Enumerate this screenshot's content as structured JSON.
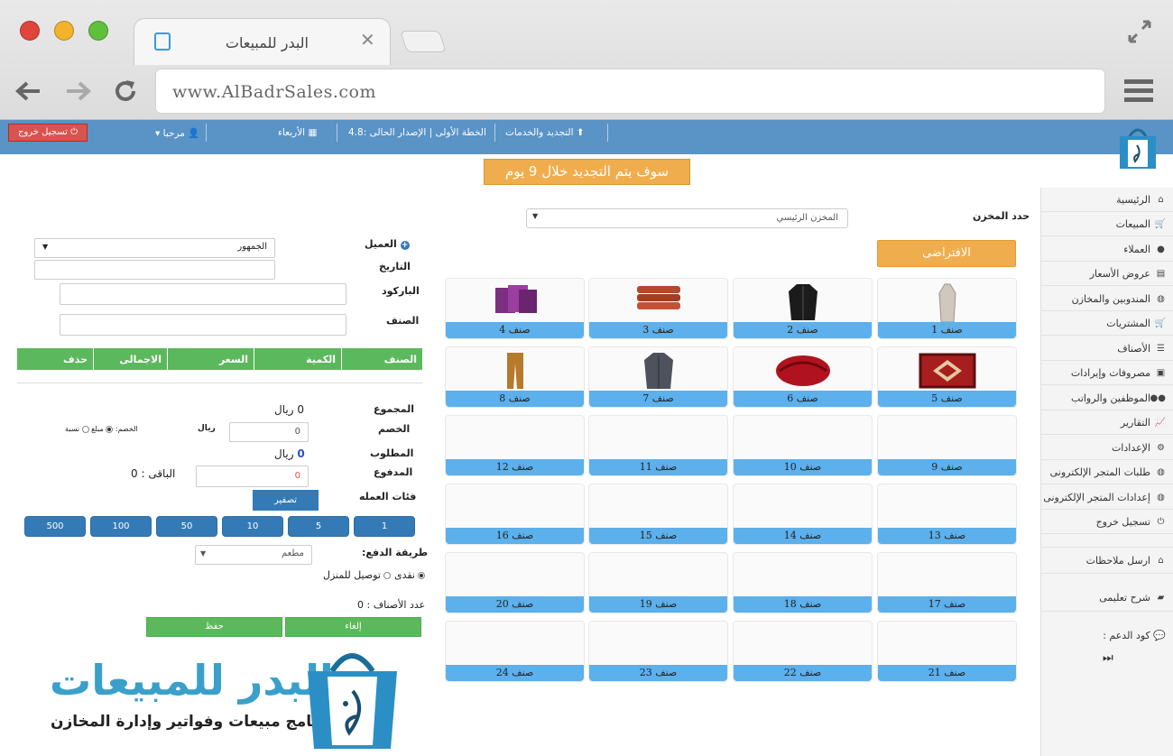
{
  "browser": {
    "tab_title": "البدر للمبيعات",
    "tab_close": "✕",
    "url": "www.AlBadrSales.com"
  },
  "topbar": {
    "logout": "تسجيل خروج",
    "welcome": "مرحبا",
    "day": "الأربعاء",
    "plan": "الخطة الأولى | الإصدار الحالى :4.8",
    "renewal": "التجديد والخدمات"
  },
  "notice": "سوف يتم التجديد خلال 9 يوم",
  "sidebar": {
    "items": [
      {
        "label": "الرئيسية",
        "icon": "home-icon"
      },
      {
        "label": "المبيعات",
        "icon": "cart-icon"
      },
      {
        "label": "العملاء",
        "icon": "user-icon"
      },
      {
        "label": "عروض الأسعار",
        "icon": "list-icon"
      },
      {
        "label": "المندوبين والمخازن",
        "icon": "globe-icon"
      },
      {
        "label": "المشتريات",
        "icon": "cart-plus-icon"
      },
      {
        "label": "الأصناف",
        "icon": "list-icon"
      },
      {
        "label": "مصروفات وإيرادات",
        "icon": "money-icon"
      },
      {
        "label": "الموظفين والرواتب",
        "icon": "users-icon"
      },
      {
        "label": "التقارير",
        "icon": "chart-icon"
      },
      {
        "label": "الإعدادات",
        "icon": "gears-icon"
      },
      {
        "label": "طلبات المتجر الإلكترونى",
        "icon": "globe-icon"
      },
      {
        "label": "إعدادات المتجر الإلكترونى",
        "icon": "globe-icon"
      },
      {
        "label": "تسجيل خروج",
        "icon": "power-icon"
      }
    ],
    "feedback": "ارسل ملاحظات",
    "tutorial": "شرح تعليمى",
    "support_code": "كود الدعم :",
    "media": "⏭"
  },
  "warehouse": {
    "label": "حدد المخزن",
    "selected": "المخزن الرئيسي",
    "default_button": "الافتراضى"
  },
  "products": [
    "صنف 1",
    "صنف 2",
    "صنف 3",
    "صنف 4",
    "صنف 5",
    "صنف 6",
    "صنف 7",
    "صنف 8",
    "صنف 9",
    "صنف 10",
    "صنف 11",
    "صنف 12",
    "صنف 13",
    "صنف 14",
    "صنف 15",
    "صنف 16",
    "صنف 17",
    "صنف 18",
    "صنف 19",
    "صنف 20",
    "صنف 21",
    "صنف 22",
    "صنف 23",
    "صنف 24"
  ],
  "pos": {
    "customer_label": "العميل",
    "customer_value": "الجمهور",
    "date_label": "التاريخ",
    "barcode_label": "الباركود",
    "item_label": "الصنف",
    "table_headers": [
      "الصنف",
      "الكمية",
      "السعر",
      "الاجمالى",
      "حذف"
    ],
    "total_label": "المجموع",
    "total_value": "0 ريال",
    "discount_label": "الخصم",
    "discount_value": "0",
    "discount_unit": "ريال",
    "discount_type_label": "الخصم:",
    "discount_type_fixed": "مبلغ",
    "discount_type_percent": "نسبة",
    "required_label": "المطلوب",
    "required_value": "0",
    "required_unit": "ريال",
    "paid_label": "المدفوع",
    "paid_value": "0",
    "remaining": "الباقى : 0",
    "denominations_label": "فئات العمله",
    "reset_button": "تصفير",
    "coins": [
      "1",
      "5",
      "10",
      "50",
      "100",
      "500"
    ],
    "payment_method_label": "طريقة الدفع:",
    "payment_method_value": "مطعم",
    "cash_label": "نقدى",
    "delivery_label": "توصيل للمنزل",
    "items_count": "عدد الأصناف :  0",
    "cancel_button": "إلغاء",
    "save_button": "حفظ"
  },
  "brand": {
    "title": "البدر للمبيعات",
    "subtitle": "برنامج مبيعات وفواتير وإدارة المخازن"
  },
  "colors": {
    "header_blue": "#5a93c6",
    "tile_blue": "#5cb0ec",
    "orange": "#f0ad4e",
    "green": "#5cb85c",
    "coin_blue": "#337ab7",
    "logout_red": "#d9534f"
  }
}
